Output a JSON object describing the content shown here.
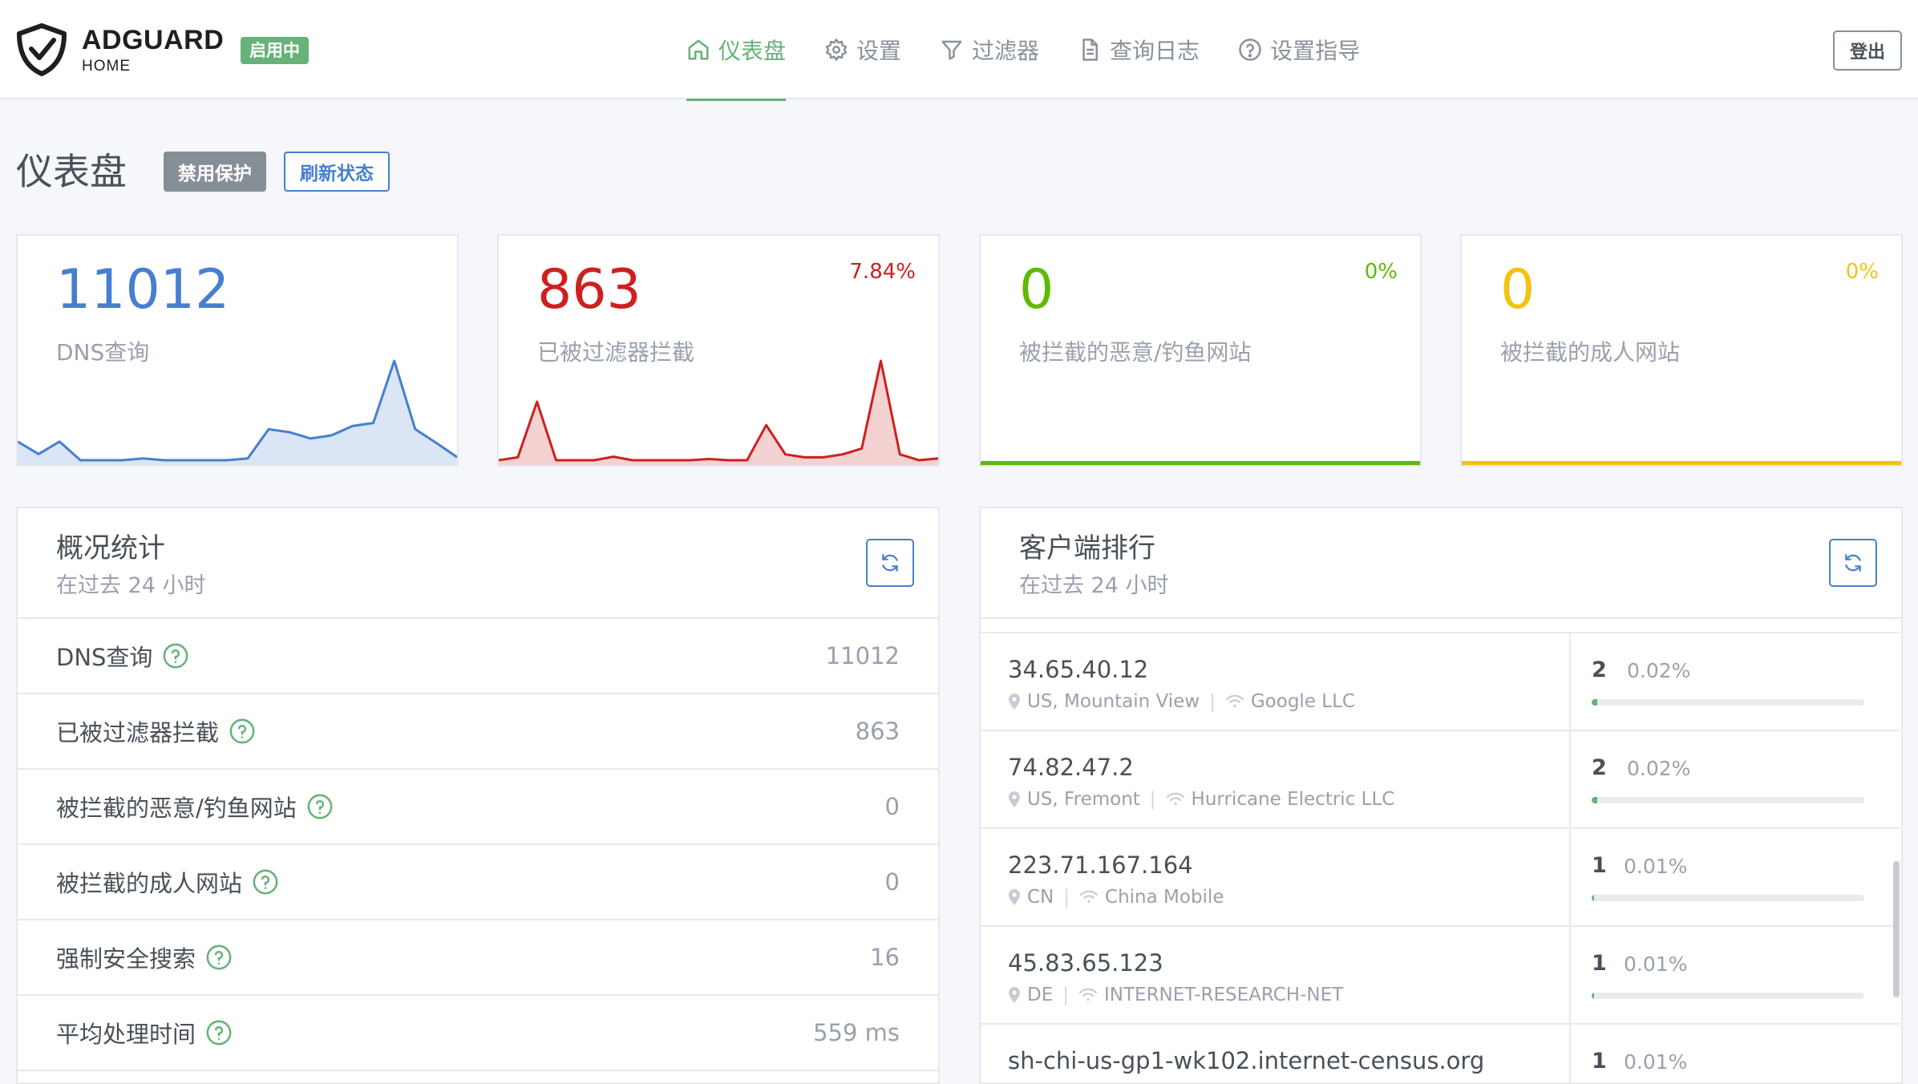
{
  "header": {
    "logo_title": "ADGUARD",
    "logo_subtitle": "HOME",
    "status_badge": "启用中",
    "nav": [
      {
        "label": "仪表盘",
        "icon": "home-icon",
        "active": true
      },
      {
        "label": "设置",
        "icon": "gear-icon",
        "active": false
      },
      {
        "label": "过滤器",
        "icon": "filter-icon",
        "active": false
      },
      {
        "label": "查询日志",
        "icon": "document-icon",
        "active": false
      },
      {
        "label": "设置指导",
        "icon": "question-circle-icon",
        "active": false
      }
    ],
    "logout_label": "登出"
  },
  "page": {
    "title": "仪表盘",
    "disable_protection_label": "禁用保护",
    "refresh_status_label": "刷新状态"
  },
  "stat_cards": [
    {
      "value": "11012",
      "label": "DNS查询",
      "percent": "",
      "color": "#467fcf",
      "series": [
        3,
        1,
        3,
        0,
        0,
        0,
        0.3,
        0,
        0,
        0,
        0,
        0.3,
        5,
        4.5,
        3.5,
        4,
        5.5,
        6,
        16,
        5,
        2.8,
        0.5
      ]
    },
    {
      "value": "863",
      "label": "已被过滤器拦截",
      "percent": "7.84%",
      "color": "#cd201f",
      "series": [
        0,
        0.5,
        10,
        0,
        0,
        0,
        0.6,
        0,
        0,
        0,
        0,
        0.2,
        0,
        0,
        6,
        1,
        0.5,
        0.5,
        1,
        2,
        17,
        1,
        0,
        0.3
      ]
    },
    {
      "value": "0",
      "label": "被拦截的恶意/钓鱼网站",
      "percent": "0%",
      "color": "#5eba00",
      "series": []
    },
    {
      "value": "0",
      "label": "被拦截的成人网站",
      "percent": "0%",
      "color": "#f1c40f",
      "series": []
    }
  ],
  "summary": {
    "title": "概况统计",
    "subtitle": "在过去 24 小时",
    "rows": [
      {
        "name": "DNS查询",
        "value": "11012"
      },
      {
        "name": "已被过滤器拦截",
        "value": "863"
      },
      {
        "name": "被拦截的恶意/钓鱼网站",
        "value": "0"
      },
      {
        "name": "被拦截的成人网站",
        "value": "0"
      },
      {
        "name": "强制安全搜索",
        "value": "16"
      },
      {
        "name": "平均处理时间",
        "value": "559 ms"
      }
    ]
  },
  "clients": {
    "title": "客户端排行",
    "subtitle": "在过去 24 小时",
    "rows": [
      {
        "ip": "34.65.40.12",
        "location": "US, Mountain View",
        "org": "Google LLC",
        "count": "2",
        "percent": "0.02%",
        "fill": 0.02
      },
      {
        "ip": "74.82.47.2",
        "location": "US, Fremont",
        "org": "Hurricane Electric LLC",
        "count": "2",
        "percent": "0.02%",
        "fill": 0.02
      },
      {
        "ip": "223.71.167.164",
        "location": "CN",
        "org": "China Mobile",
        "count": "1",
        "percent": "0.01%",
        "fill": 0.01
      },
      {
        "ip": "45.83.65.123",
        "location": "DE",
        "org": "INTERNET-RESEARCH-NET",
        "count": "1",
        "percent": "0.01%",
        "fill": 0.01
      },
      {
        "ip": "sh-chi-us-gp1-wk102.internet-census.org",
        "location": "",
        "org": "",
        "count": "1",
        "percent": "0.01%",
        "fill": 0.01
      }
    ]
  }
}
